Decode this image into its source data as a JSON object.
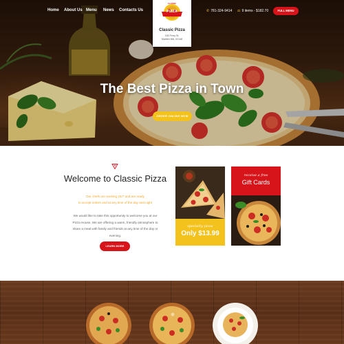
{
  "nav": {
    "items": [
      {
        "label": "Home"
      },
      {
        "label": "About Us"
      },
      {
        "label": "Menu"
      },
      {
        "label": "News"
      },
      {
        "label": "Contacts Us"
      }
    ]
  },
  "logo": {
    "badge_top": "CLASSIC",
    "badge_main": "PIZZA",
    "name": "Classic Pizza",
    "address_line1": "190 Ferry St,",
    "address_line2": "Malden MA, 02148"
  },
  "header": {
    "phone": "781-324-9414",
    "cart": "9 items - $182.70",
    "full_menu_label": "Full Menu"
  },
  "hero": {
    "title": "The Best Pizza in Town",
    "cta_label": "ORDER ONLINE NOW"
  },
  "welcome": {
    "title": "Welcome to Classic Pizza",
    "subtitle_line1": "Our chefs are working 24/7 and are ready",
    "subtitle_line2": "to accept orders and at any time of the day and night",
    "body_line1": "We would like to take this opportunity to welcome you at our",
    "body_line2": "Pizza House. We are offering a warm, friendly atmosphere to",
    "body_line3": "share a meal with family and friends at any time of the day or",
    "body_line4": "evening.",
    "cta_label": "LEARN MORE"
  },
  "promos": {
    "special": {
      "script": "specialty pizza",
      "price": "Only $13.99"
    },
    "gift": {
      "script": "receive a free",
      "title": "Gift Cards"
    }
  },
  "colors": {
    "accent_red": "#d8141b",
    "accent_yellow": "#f4c21c",
    "subtitle_orange": "#f2a72a",
    "wood": "#5b3019"
  },
  "icons": {
    "phone": "phone-icon",
    "cart": "cart-icon",
    "divider": "pizza-slice-icon"
  }
}
